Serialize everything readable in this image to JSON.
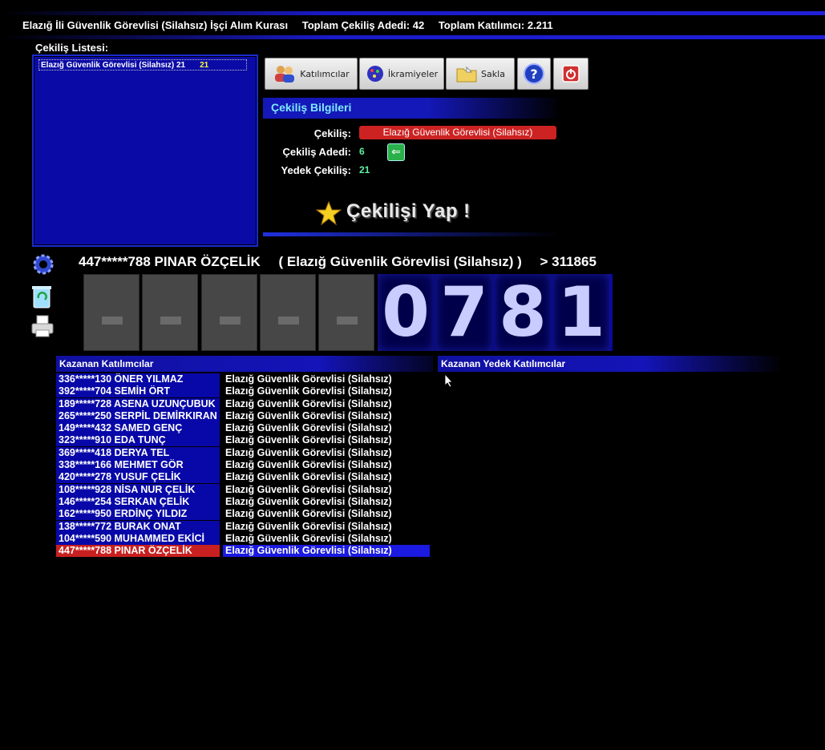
{
  "header": {
    "title": "Elazığ İli Güvenlik Görevlisi (Silahsız) İşçi Alım Kurası",
    "total_draws": "Toplam Çekiliş Adedi: 42",
    "total_participants": "Toplam Katılımcı: 2.211"
  },
  "draw_list": {
    "label": "Çekiliş Listesi:",
    "items": [
      {
        "name": "Elazığ Güvenlik Görevlisi (Silahsız) 21",
        "count": "21"
      }
    ]
  },
  "toolbar": {
    "participants_label": "Katılımcılar",
    "prizes_label": "İkramiyeler",
    "save_label": "Sakla"
  },
  "info": {
    "header": "Çekiliş Bilgileri",
    "draw_label": "Çekiliş:",
    "draw_value": "Elazığ Güvenlik Görevlisi (Silahsız)",
    "count_label": "Çekiliş Adedi:",
    "count_value": "6",
    "reserve_label": "Yedek Çekiliş:",
    "reserve_value": "21",
    "action_label": "Çekilişi Yap !"
  },
  "ticker": {
    "winner": "447*****788 PINAR ÖZÇELİK",
    "category": "( Elazığ Güvenlik Görevlisi (Silahsız) )",
    "next": "> 311865"
  },
  "digits": [
    "-",
    "-",
    "-",
    "-",
    "-",
    "0",
    "7",
    "8",
    "1"
  ],
  "winners": {
    "header": "Kazanan Katılımcılar",
    "rows": [
      {
        "name": "336*****130 ÖNER YILMAZ",
        "category": "Elazığ Güvenlik Görevlisi (Silahsız)"
      },
      {
        "name": "392*****704 SEMİH ÖRT",
        "category": "Elazığ Güvenlik Görevlisi (Silahsız)"
      },
      {
        "name": "189*****728 ASENA UZUNÇUBUK",
        "category": "Elazığ Güvenlik Görevlisi (Silahsız)"
      },
      {
        "name": "265*****250 SERPİL DEMİRKIRAN",
        "category": "Elazığ Güvenlik Görevlisi (Silahsız)"
      },
      {
        "name": "149*****432 SAMED GENÇ",
        "category": "Elazığ Güvenlik Görevlisi (Silahsız)"
      },
      {
        "name": "323*****910 EDA TUNÇ",
        "category": "Elazığ Güvenlik Görevlisi (Silahsız)"
      },
      {
        "name": "369*****418 DERYA TEL",
        "category": "Elazığ Güvenlik Görevlisi (Silahsız)"
      },
      {
        "name": "338*****166 MEHMET GÖR",
        "category": "Elazığ Güvenlik Görevlisi (Silahsız)"
      },
      {
        "name": "420*****278 YUSUF ÇELİK",
        "category": "Elazığ Güvenlik Görevlisi (Silahsız)"
      },
      {
        "name": "108*****928 NİSA NUR ÇELİK",
        "category": "Elazığ Güvenlik Görevlisi (Silahsız)"
      },
      {
        "name": "146*****254 SERKAN ÇELİK",
        "category": "Elazığ Güvenlik Görevlisi (Silahsız)"
      },
      {
        "name": "162*****950 ERDİNÇ YILDIZ",
        "category": "Elazığ Güvenlik Görevlisi (Silahsız)"
      },
      {
        "name": "138*****772 BURAK ONAT",
        "category": "Elazığ Güvenlik Görevlisi (Silahsız)"
      },
      {
        "name": "104*****590 MUHAMMED EKİCİ",
        "category": "Elazığ Güvenlik Görevlisi (Silahsız)"
      },
      {
        "name": "447*****788 PINAR ÖZÇELİK",
        "category": "Elazığ Güvenlik Görevlisi (Silahsız)"
      }
    ]
  },
  "reserve": {
    "header": "Kazanan Yedek Katılımcılar"
  },
  "colors": {
    "accent_blue": "#1418b8",
    "highlight_red": "#c82020",
    "label_cyan": "#7fe8ff",
    "value_green": "#60f0a0"
  }
}
